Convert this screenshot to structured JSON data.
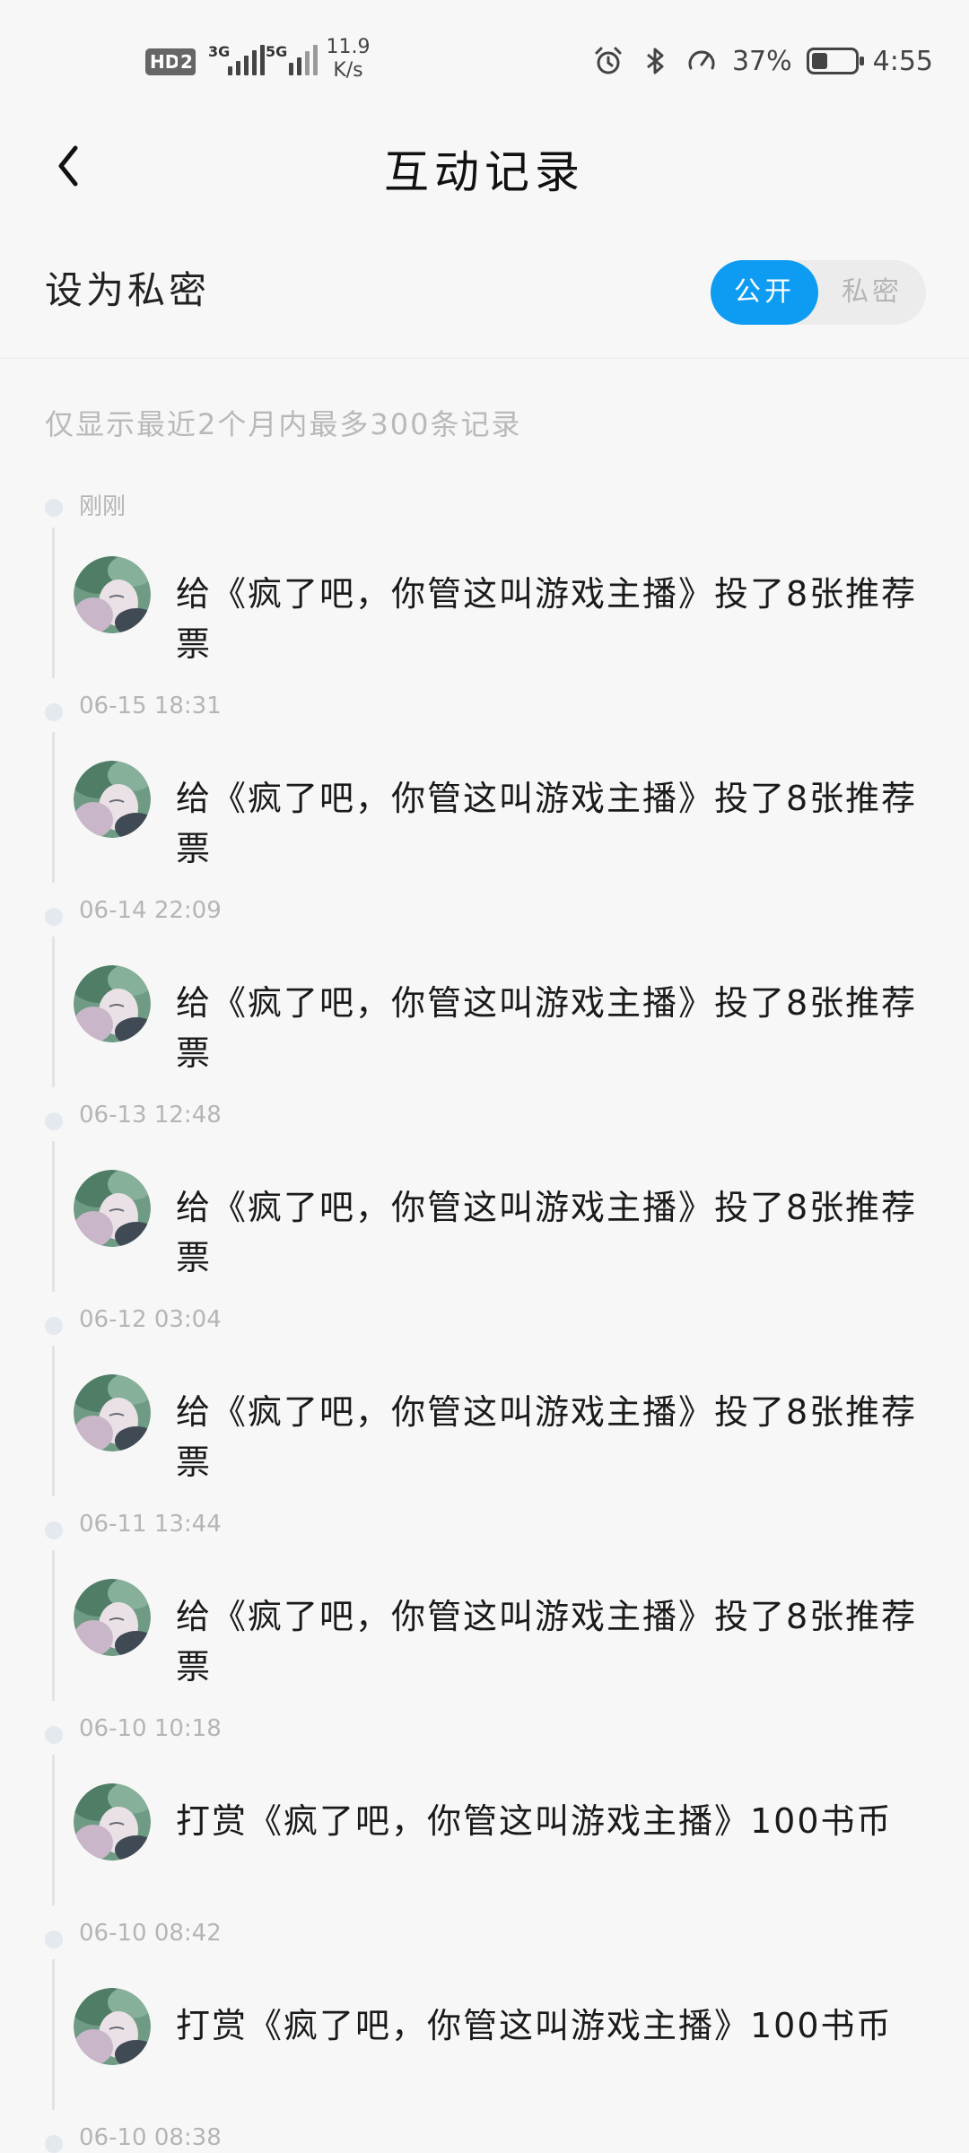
{
  "status_bar": {
    "hd_label": "HD",
    "sim_label": "2",
    "net1_label": "3G",
    "net2_label": "5G",
    "speed_value": "11.9",
    "speed_unit": "K/s",
    "battery_percent": "37%",
    "battery_level": 0.37,
    "time": "4:55",
    "icons": [
      "alarm-icon",
      "bluetooth-icon",
      "data-saver-icon"
    ]
  },
  "header": {
    "title": "互动记录",
    "back_icon": "chevron-left-icon"
  },
  "privacy": {
    "label": "设为私密",
    "option_public": "公开",
    "option_private": "私密",
    "selected": "公开",
    "accent_color": "#0d9cf2"
  },
  "notice": "仅显示最近2个月内最多300条记录",
  "records": [
    {
      "time": "刚刚",
      "text": "给《疯了吧，你管这叫游戏主播》投了8张推荐票"
    },
    {
      "time": "06-15 18:31",
      "text": "给《疯了吧，你管这叫游戏主播》投了8张推荐票"
    },
    {
      "time": "06-14 22:09",
      "text": "给《疯了吧，你管这叫游戏主播》投了8张推荐票"
    },
    {
      "time": "06-13 12:48",
      "text": "给《疯了吧，你管这叫游戏主播》投了8张推荐票"
    },
    {
      "time": "06-12 03:04",
      "text": "给《疯了吧，你管这叫游戏主播》投了8张推荐票"
    },
    {
      "time": "06-11 13:44",
      "text": "给《疯了吧，你管这叫游戏主播》投了8张推荐票"
    },
    {
      "time": "06-10 10:18",
      "text": "打赏《疯了吧，你管这叫游戏主播》100书币"
    },
    {
      "time": "06-10 08:42",
      "text": "打赏《疯了吧，你管这叫游戏主播》100书币"
    },
    {
      "time": "06-10 08:38",
      "text": ""
    }
  ]
}
